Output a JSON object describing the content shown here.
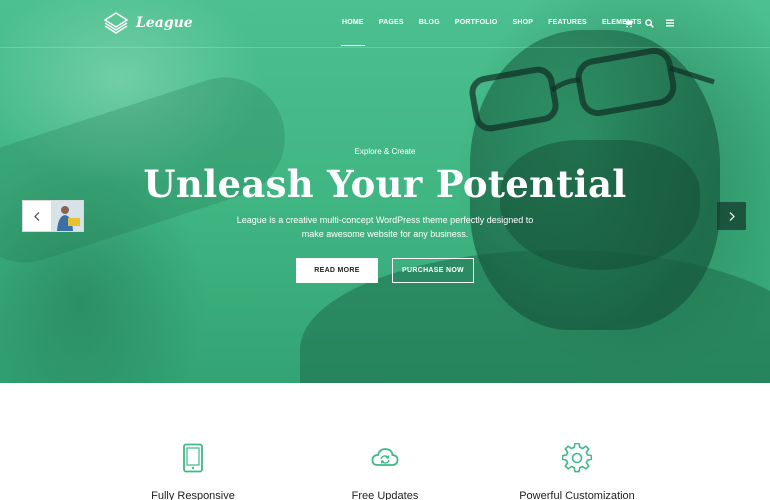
{
  "brand": {
    "name": "League",
    "accent_color": "#3dba86"
  },
  "nav": {
    "items": [
      {
        "label": "HOME",
        "active": true
      },
      {
        "label": "PAGES",
        "active": false
      },
      {
        "label": "BLOG",
        "active": false
      },
      {
        "label": "PORTFOLIO",
        "active": false
      },
      {
        "label": "SHOP",
        "active": false
      },
      {
        "label": "FEATURES",
        "active": false
      },
      {
        "label": "ELEMENTS",
        "active": false
      }
    ],
    "icons": [
      "cart-icon",
      "search-icon",
      "menu-icon"
    ]
  },
  "hero": {
    "kicker": "Explore & Create",
    "headline": "Unleash Your Potential",
    "description": "League is a creative multi-concept WordPress theme perfectly designed to make awesome website for any business.",
    "primary_button": "READ MORE",
    "secondary_button": "PURCHASE NOW"
  },
  "features": [
    {
      "title": "Fully Responsive",
      "icon": "tablet-icon"
    },
    {
      "title": "Free Updates",
      "icon": "cloud-sync-icon"
    },
    {
      "title": "Powerful Customization",
      "icon": "gear-icon"
    }
  ]
}
